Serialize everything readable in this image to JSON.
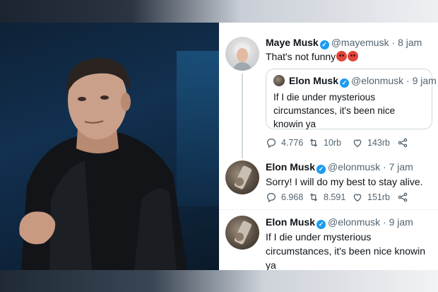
{
  "photo": {
    "subject": ""
  },
  "tweets": [
    {
      "name": "Maye Musk",
      "handle": "@mayemusk",
      "time": "8 jam",
      "text": "That's not funny",
      "quote": {
        "name": "Elon Musk",
        "handle": "@elonmusk",
        "time": "9 jam",
        "text": "If I die under mysterious circumstances, it's been nice knowin ya"
      },
      "replies": "4.776",
      "retweets": "10rb",
      "likes": "143rb"
    },
    {
      "name": "Elon Musk",
      "handle": "@elonmusk",
      "time": "7 jam",
      "text": "Sorry! I will do my best to stay alive.",
      "replies": "6.968",
      "retweets": "8.591",
      "likes": "151rb"
    },
    {
      "name": "Elon Musk",
      "handle": "@elonmusk",
      "time": "9 jam",
      "text": "If I die under mysterious circumstances, it's been nice knowin ya"
    }
  ],
  "icons": {
    "verified": "verified-badge-icon",
    "reply": "reply-icon",
    "retweet": "retweet-icon",
    "like": "heart-icon",
    "share": "share-icon",
    "emoji": "angry-face-emoji"
  },
  "colors": {
    "accent": "#1d9bf0",
    "muted": "#536471",
    "text": "#0f1419"
  }
}
